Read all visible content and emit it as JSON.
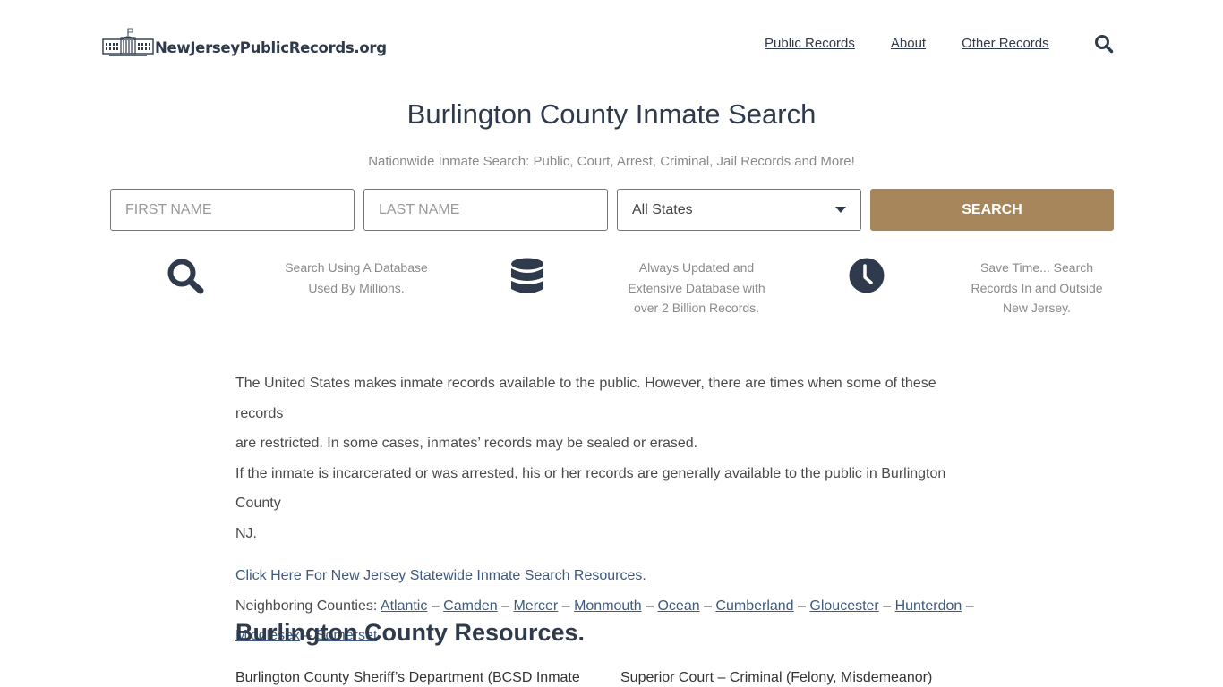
{
  "header": {
    "logo_text": "NewJerseyPublicRecords.org",
    "nav": [
      "Public Records",
      "About",
      "Other Records"
    ],
    "search_icon": "search-icon"
  },
  "hero": {
    "title": "Burlington County Inmate Search",
    "subtitle": "Nationwide Inmate Search: Public, Court, Arrest, Criminal, Jail Records and More!",
    "first_name_placeholder": "FIRST NAME",
    "last_name_placeholder": "LAST NAME",
    "state_selected": "All States",
    "search_label": "SEARCH",
    "accent_color": "#a8865c"
  },
  "features": [
    {
      "icon": "search-icon",
      "lines": [
        "Search Using A Database",
        "Used By Millions."
      ]
    },
    {
      "icon": "database-icon",
      "lines": [
        "Always Updated and",
        "Extensive Database with",
        "over 2 Billion Records."
      ]
    },
    {
      "icon": "clock-icon",
      "lines": [
        "Save Time... Search",
        "Records In and Outside",
        "New Jersey."
      ]
    }
  ],
  "content": {
    "para1_line1": "The United States makes inmate records available to the public. However, there are times when some of these records",
    "para1_line2": "are restricted. In some cases, inmates’ records may be sealed or erased.",
    "para2_line1": "If the inmate is incarcerated or was arrested, his or her records are generally available to the public in Burlington County",
    "para2_line2": "NJ.",
    "statewide_link": "Click Here For New Jersey Statewide Inmate Search Resources.",
    "neighbors_label": "Neighboring Counties:",
    "neighbors": [
      "Atlantic",
      "Camden",
      "Mercer",
      "Monmouth",
      "Ocean",
      "Cumberland",
      "Gloucester",
      "Hunterdon",
      "Middlesex",
      "Somerset"
    ],
    "separator": "–"
  },
  "resources": {
    "heading": "Burlington County Resources.",
    "col1": "Burlington County Sheriff’s Department (BCSD Inmate",
    "col2": "Superior Court – Criminal (Felony, Misdemeanor)"
  }
}
